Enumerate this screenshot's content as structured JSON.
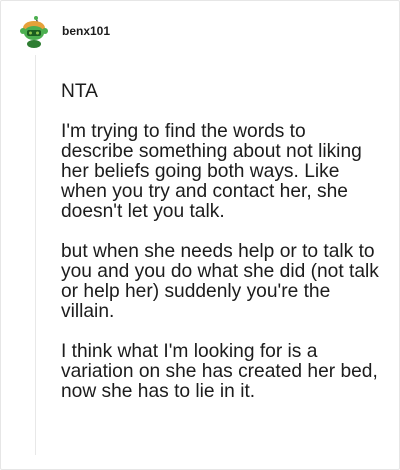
{
  "comment": {
    "author": "benx101",
    "avatar_icon": "snoo-avatar-icon",
    "paragraphs": [
      "NTA",
      "I'm trying to find the words to describe something about not liking her beliefs going both ways. Like when you try and contact her, she doesn't let you talk.",
      "but when she needs help or to talk to you and you do what she did (not talk or help her) suddenly you're the villain.",
      "I think what I'm looking for is a variation on she has created her bed, now she has to lie in it."
    ]
  },
  "colors": {
    "avatar_green": "#4caf50",
    "avatar_face": "#1a5e20",
    "avatar_hat": "#e6a13a",
    "text": "#1c1c1c",
    "thread_line": "#e8e8e8"
  }
}
